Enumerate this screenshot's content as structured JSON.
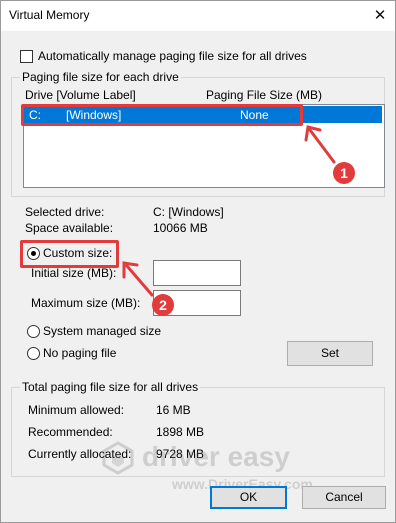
{
  "window": {
    "title": "Virtual Memory",
    "close_glyph": "✕"
  },
  "auto_manage": {
    "label": "Automatically manage paging file size for all drives",
    "checked": false
  },
  "per_drive": {
    "legend": "Paging file size for each drive",
    "col_drive": "Drive  [Volume Label]",
    "col_size": "Paging File Size (MB)",
    "rows": [
      {
        "drive": "C:",
        "label": "[Windows]",
        "size": "None"
      }
    ]
  },
  "selected": {
    "drive_label": "Selected drive:",
    "drive_value": "C:  [Windows]",
    "space_label": "Space available:",
    "space_value": "10066 MB"
  },
  "options": {
    "custom": "Custom size:",
    "initial_label": "Initial size (MB):",
    "maximum_label": "Maximum size (MB):",
    "initial_value": "",
    "maximum_value": "",
    "system": "System managed size",
    "none": "No paging file",
    "set_button": "Set"
  },
  "totals": {
    "legend": "Total paging file size for all drives",
    "min_label": "Minimum allowed:",
    "min_value": "16 MB",
    "rec_label": "Recommended:",
    "rec_value": "1898 MB",
    "cur_label": "Currently allocated:",
    "cur_value": "9728 MB"
  },
  "buttons": {
    "ok": "OK",
    "cancel": "Cancel"
  },
  "annotations": {
    "badge1": "1",
    "badge2": "2",
    "color": "#e23b3b"
  },
  "watermark": {
    "brand": "driver easy",
    "url": "www.DriverEasy.com"
  }
}
